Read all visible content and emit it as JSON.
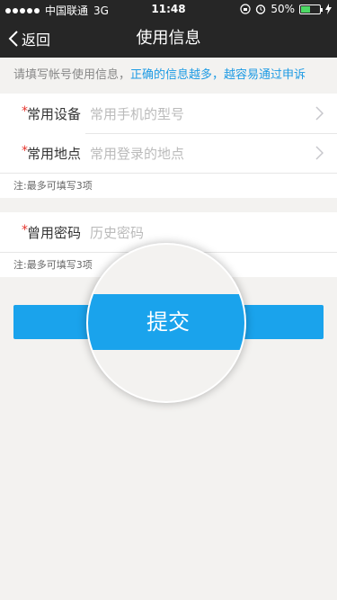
{
  "status": {
    "carrier": "中国联通",
    "network": "3G",
    "time": "11:48",
    "battery": "50%",
    "battery_level": 0.5
  },
  "nav": {
    "back_label": "返回",
    "title": "使用信息"
  },
  "hint": {
    "prefix": "请填写帐号使用信息，",
    "highlight": "正确的信息越多，越容易通过申诉"
  },
  "group1": {
    "rows": [
      {
        "required": "*",
        "label": "常用设备",
        "placeholder": "常用手机的型号"
      },
      {
        "required": "*",
        "label": "常用地点",
        "placeholder": "常用登录的地点"
      }
    ],
    "note": "注:最多可填写3项"
  },
  "group2": {
    "rows": [
      {
        "required": "*",
        "label": "曾用密码",
        "placeholder": "历史密码"
      }
    ],
    "note": "注:最多可填写3项"
  },
  "submit_label": "提交",
  "colors": {
    "accent": "#1aa3ec",
    "required": "#e5322b",
    "bar": "#262626"
  }
}
